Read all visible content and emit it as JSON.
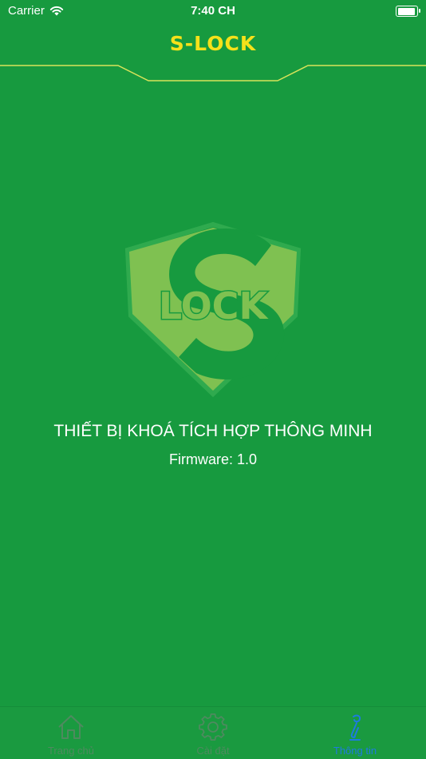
{
  "status_bar": {
    "carrier": "Carrier",
    "time": "7:40 CH"
  },
  "header": {
    "logo_text": "S-LOCK"
  },
  "main": {
    "emblem_text": "LOCK",
    "title": "THIẾT BỊ KHOÁ TÍCH HỢP THÔNG MINH",
    "firmware": "Firmware: 1.0"
  },
  "tab_bar": {
    "tabs": [
      {
        "label": "Trang chủ",
        "icon": "home-icon"
      },
      {
        "label": "Cài đặt",
        "icon": "gear-icon"
      },
      {
        "label": "Thông tin",
        "icon": "info-icon",
        "active": true
      }
    ]
  },
  "colors": {
    "background": "#179A3F",
    "logo": "#F6E11A",
    "emblem": "#7FC151",
    "tab_active": "#1E7BE0",
    "tab_inactive": "#4E8A5F"
  }
}
